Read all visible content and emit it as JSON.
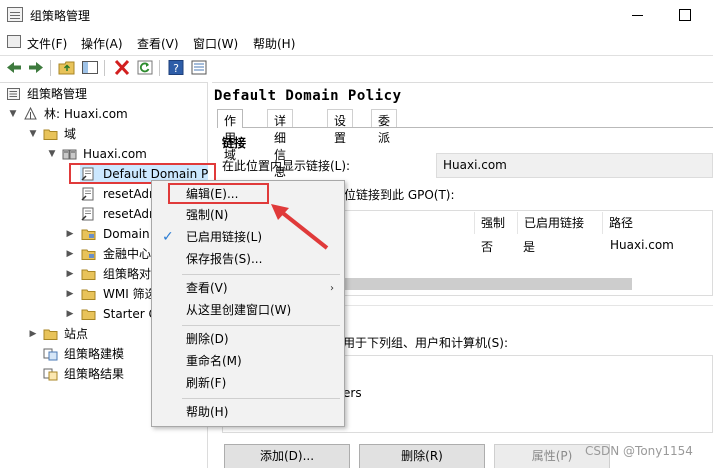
{
  "window": {
    "title": "组策略管理"
  },
  "menubar": [
    "文件(F)",
    "操作(A)",
    "查看(V)",
    "窗口(W)",
    "帮助(H)"
  ],
  "toolbar": [
    "back-icon",
    "forward-icon",
    "up-folder-icon",
    "show-hide-tree-icon",
    "delete-icon",
    "refresh-icon",
    "help-icon",
    "properties-icon"
  ],
  "tree": [
    {
      "label": "组策略管理",
      "icon": "gpm-icon"
    },
    {
      "label": "林: Huaxi.com",
      "icon": "forest-icon"
    },
    {
      "label": "域",
      "icon": "folder-icon"
    },
    {
      "label": "Huaxi.com",
      "icon": "domain-icon"
    },
    {
      "label": "Default Domain P",
      "icon": "gpo-link-icon"
    },
    {
      "label": "resetAdr",
      "icon": "gpo-link-icon"
    },
    {
      "label": "resetAdr",
      "icon": "gpo-link-icon"
    },
    {
      "label": "Domain",
      "icon": "ou-icon"
    },
    {
      "label": "金融中心",
      "icon": "ou-icon"
    },
    {
      "label": "组策略对",
      "icon": "folder-icon"
    },
    {
      "label": "WMI 筛选",
      "icon": "folder-icon"
    },
    {
      "label": "Starter G",
      "icon": "folder-icon"
    },
    {
      "label": "站点",
      "icon": "sites-icon"
    },
    {
      "label": "组策略建模",
      "icon": "modeling-icon"
    },
    {
      "label": "组策略结果",
      "icon": "results-icon"
    }
  ],
  "details": {
    "title": "Default Domain Policy",
    "tabs": [
      "作用域",
      "详细信息",
      "设置",
      "委派"
    ],
    "links_heading": "链接",
    "location_label": "在此位置内显示链接(L):",
    "location_value": "Huaxi.com",
    "links_label": "位链接到此 GPO(T):",
    "columns": [
      "强制",
      "已启用链接",
      "路径"
    ],
    "row": [
      "否",
      "是",
      "Huaxi.com"
    ],
    "filter_label": "用于下列组、用户和计算机(S):",
    "filter_item": "ers",
    "buttons": {
      "add": "添加(D)...",
      "remove": "删除(R)",
      "properties": "属性(P)"
    }
  },
  "context_menu": {
    "items": [
      {
        "label": "编辑(E)...",
        "check": ""
      },
      {
        "label": "强制(N)",
        "check": ""
      },
      {
        "label": "已启用链接(L)",
        "check": "✓"
      },
      {
        "label": "保存报告(S)...",
        "check": ""
      },
      {
        "label": "查看(V)",
        "check": "",
        "submenu": "›"
      },
      {
        "label": "从这里创建窗口(W)",
        "check": ""
      },
      {
        "label": "删除(D)",
        "check": ""
      },
      {
        "label": "重命名(M)",
        "check": ""
      },
      {
        "label": "刷新(F)",
        "check": ""
      },
      {
        "label": "帮助(H)",
        "check": ""
      }
    ]
  },
  "watermark": "CSDN @Tony1154",
  "colors": {
    "selection": "#cce8ff",
    "annotation_red": "#e03a3a",
    "check_blue": "#2b7cd3"
  }
}
